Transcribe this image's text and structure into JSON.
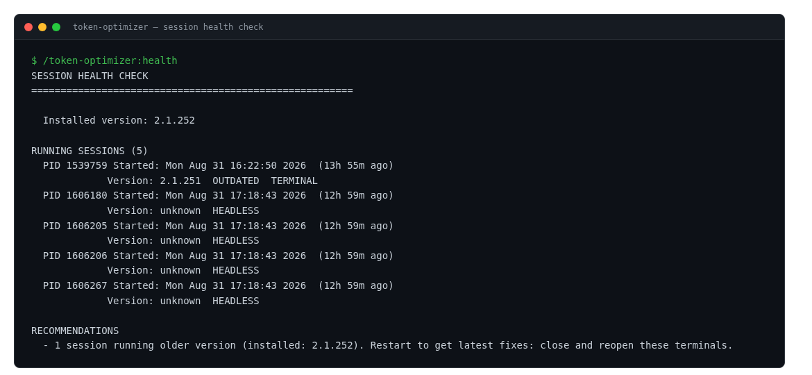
{
  "window": {
    "title": "token-optimizer — session health check"
  },
  "command": "$ /token-optimizer:health",
  "heading": "SESSION HEALTH CHECK",
  "rule": "=======================================================",
  "installed": "Installed version: 2.1.252",
  "sessions": {
    "title": "RUNNING SESSIONS (5)",
    "items": [
      {
        "started": "PID 1539759 Started: Mon Aug 31 16:22:50 2026  (13h 55m ago)",
        "version": "Version: 2.1.251  OUTDATED  TERMINAL"
      },
      {
        "started": "PID 1606180 Started: Mon Aug 31 17:18:43 2026  (12h 59m ago)",
        "version": "Version: unknown  HEADLESS"
      },
      {
        "started": "PID 1606205 Started: Mon Aug 31 17:18:43 2026  (12h 59m ago)",
        "version": "Version: unknown  HEADLESS"
      },
      {
        "started": "PID 1606206 Started: Mon Aug 31 17:18:43 2026  (12h 59m ago)",
        "version": "Version: unknown  HEADLESS"
      },
      {
        "started": "PID 1606267 Started: Mon Aug 31 17:18:43 2026  (12h 59m ago)",
        "version": "Version: unknown  HEADLESS"
      }
    ]
  },
  "recommendations": {
    "title": "RECOMMENDATIONS",
    "items": [
      "- 1 session running older version (installed: 2.1.252). Restart to get latest fixes: close and reopen these terminals."
    ]
  }
}
